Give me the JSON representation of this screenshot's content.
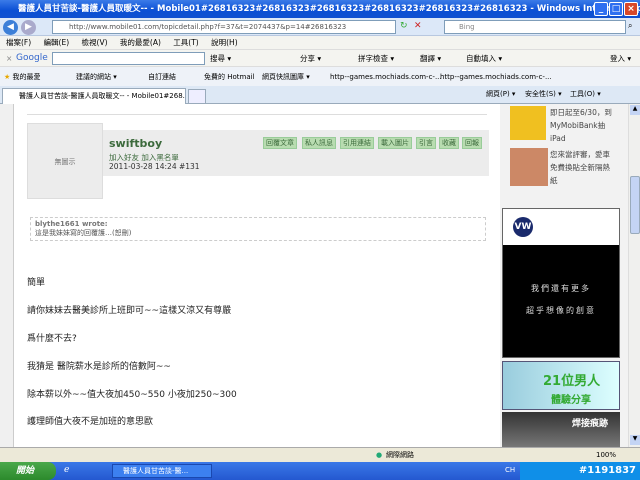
{
  "window": {
    "title": "醫護人員甘苦談-醫護人員取暖文-- - Mobile01#26816323#26816323#26816323#26816323#26816323#26816323 - Windows Internet Explorer"
  },
  "address": {
    "url": "http://www.mobile01.com/topicdetail.php?f=37&t=2074437&p=14#26816323",
    "search_placeholder": "Bing"
  },
  "menu": [
    "檔案(F)",
    "編輯(E)",
    "檢視(V)",
    "我的最愛(A)",
    "工具(T)",
    "說明(H)"
  ],
  "google_toolbar": {
    "logo": "Google",
    "items": [
      "搜尋 ▾",
      "分享 ▾",
      "拼字檢查 ▾",
      "翻譯 ▾",
      "自動填入 ▾",
      "登入 ▾"
    ]
  },
  "favorites": {
    "label": "我的最愛",
    "items": [
      "建議的網站 ▾",
      "自訂連結",
      "免費的 Hotmail",
      "網頁快訊圖庫 ▾",
      "http--games.mochiads.com-c-...",
      "http--games.mochiads.com-c-..."
    ]
  },
  "tab": {
    "title": "醫護人員甘苦談-醫護人員取暖文-- - Mobile01#268...",
    "commands": [
      "網頁(P) ▾",
      "安全性(S) ▾",
      "工具(O) ▾"
    ]
  },
  "post": {
    "avatar_text": "無圖示",
    "username": "swiftboy",
    "user_links": "加入好友  加入黑名單",
    "date": "2011-03-28 14:24  #131",
    "actions": [
      "回覆文章",
      "私人訊息",
      "引用連結",
      "載入圖片",
      "引言",
      "收藏",
      "回報"
    ],
    "quote_author": "blythe1661 wrote:",
    "quote_text": "這是我妹妹寫的回覆護…(恕刪)",
    "lines": [
      "簡單",
      "請你妹妹去醫美診所上班即可~~這樣又涼又有尊嚴",
      "爲什麼不去?",
      "我猜是 醫院薪水是診所的倍數阿~~",
      "除本薪以外~~值大夜加450~550 小夜加250~300",
      "護理師值大夜不是加班的意思歐"
    ]
  },
  "sidebar": {
    "ad1": "即日起至6/30，到MyMobiBank抽iPad",
    "ad2": "您來當評審，愛車免費換貼全新隔熱紙",
    "vw_line1": "我們還有更多",
    "vw_line2": "超乎想像的創意",
    "ad21_big": "21位男人",
    "ad21_small": "體驗分享",
    "ad_weld": "焊接痕跡"
  },
  "status": {
    "zone": "網際網路",
    "zoom": "100%"
  },
  "taskbar": {
    "start": "開始",
    "task": "醫護人員甘苦談-醫...",
    "tray_id": "#1191837",
    "lang": "CH"
  }
}
